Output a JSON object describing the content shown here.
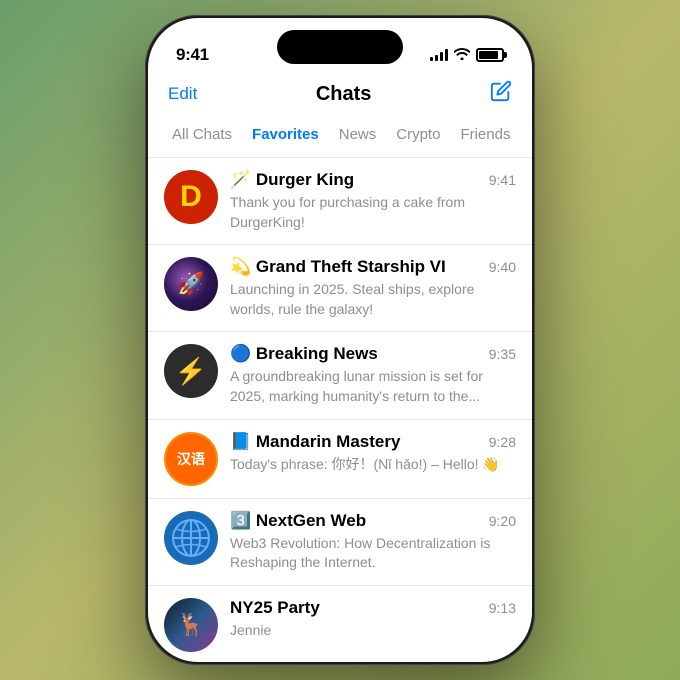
{
  "statusBar": {
    "time": "9:41"
  },
  "header": {
    "editLabel": "Edit",
    "title": "Chats"
  },
  "tabs": [
    {
      "id": "all",
      "label": "All Chats",
      "active": false
    },
    {
      "id": "favorites",
      "label": "Favorites",
      "active": true
    },
    {
      "id": "news",
      "label": "News",
      "active": false
    },
    {
      "id": "crypto",
      "label": "Crypto",
      "active": false
    },
    {
      "id": "friends",
      "label": "Friends",
      "active": false
    }
  ],
  "chats": [
    {
      "id": "durger-king",
      "name": "🪄 Durger King",
      "preview": "Thank you for purchasing a cake from DurgerKing!",
      "time": "9:41",
      "avatarType": "durger",
      "avatarText": "D"
    },
    {
      "id": "grand-theft-starship",
      "name": "💫 Grand Theft Starship VI",
      "preview": "Launching in 2025. Steal ships, explore worlds, rule the galaxy!",
      "time": "9:40",
      "avatarType": "gts",
      "avatarText": "🚀"
    },
    {
      "id": "breaking-news",
      "name": "🔵 Breaking News",
      "preview": "A groundbreaking lunar mission is set for 2025, marking humanity's return to the...",
      "time": "9:35",
      "avatarType": "breaking",
      "avatarText": "⚡"
    },
    {
      "id": "mandarin-mastery",
      "name": "📘 Mandarin Mastery",
      "preview": "Today's phrase:\n你好！(Nǐ hǎo!) – Hello! 👋",
      "time": "9:28",
      "avatarType": "mandarin",
      "avatarText": "汉语"
    },
    {
      "id": "nextgen-web",
      "name": "3️⃣ NextGen Web",
      "preview": "Web3 Revolution: How Decentralization is Reshaping the Internet.",
      "time": "9:20",
      "avatarType": "nextgen"
    },
    {
      "id": "ny25-party",
      "name": "NY25 Party",
      "preview": "Jennie",
      "time": "9:13",
      "avatarType": "ny25"
    }
  ]
}
